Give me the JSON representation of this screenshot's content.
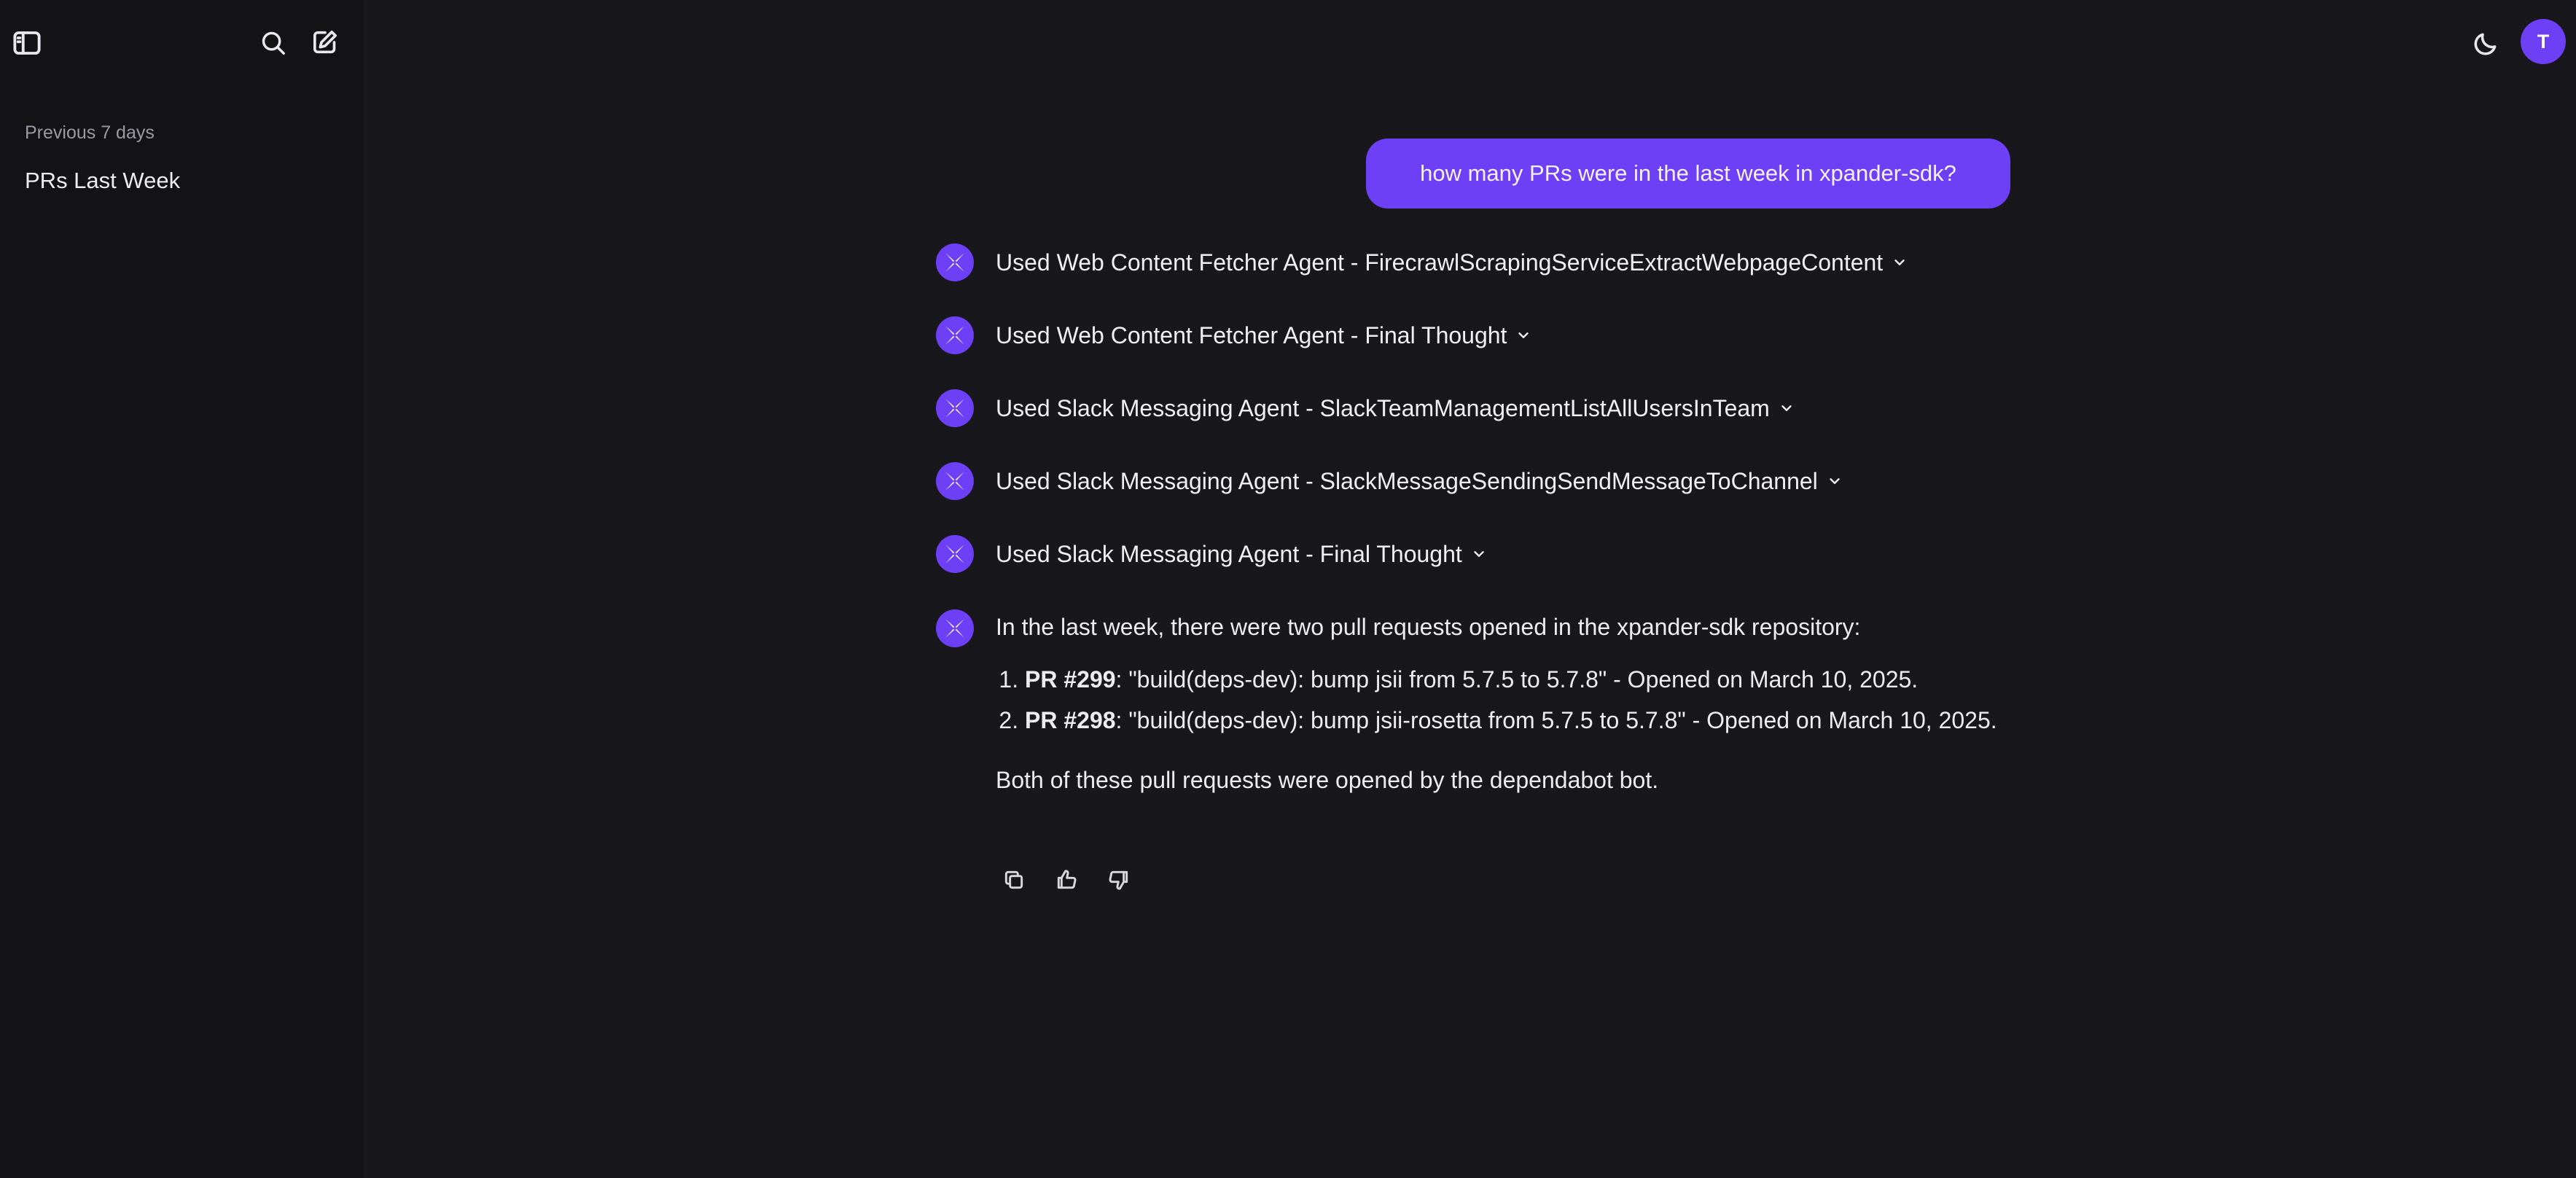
{
  "sidebar": {
    "section_label": "Previous 7 days",
    "items": [
      {
        "label": "PRs Last Week"
      }
    ],
    "icons": [
      "sidebar-toggle-icon",
      "search-icon",
      "new-chat-icon"
    ]
  },
  "header": {
    "theme_icon": "moon-icon",
    "avatar_initial": "T"
  },
  "conversation": {
    "user_message": "how many PRs were in the last week in xpander-sdk?",
    "tool_steps": [
      {
        "label": "Used Web Content Fetcher Agent - FirecrawlScrapingServiceExtractWebpageContent"
      },
      {
        "label": "Used Web Content Fetcher Agent - Final Thought"
      },
      {
        "label": "Used Slack Messaging Agent - SlackTeamManagementListAllUsersInTeam"
      },
      {
        "label": "Used Slack Messaging Agent - SlackMessageSendingSendMessageToChannel"
      },
      {
        "label": "Used Slack Messaging Agent - Final Thought"
      }
    ],
    "answer": {
      "intro": "In the last week, there were two pull requests opened in the xpander-sdk repository:",
      "items": [
        {
          "pr": "PR #299",
          "text": ": \"build(deps-dev): bump jsii from 5.7.5 to 5.7.8\" - Opened on March 10, 2025."
        },
        {
          "pr": "PR #298",
          "text": ": \"build(deps-dev): bump jsii-rosetta from 5.7.5 to 5.7.8\" - Opened on March 10, 2025."
        }
      ],
      "closing": "Both of these pull requests were opened by the dependabot bot."
    },
    "actions": [
      "copy-icon",
      "thumbs-up-icon",
      "thumbs-down-icon"
    ]
  },
  "colors": {
    "accent": "#6d3ff5",
    "background": "#18181c",
    "sidebar": "#131316"
  }
}
